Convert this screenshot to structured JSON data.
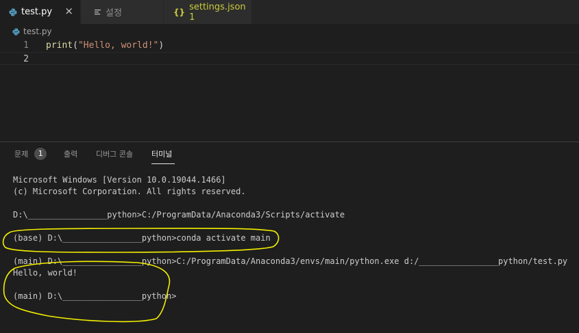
{
  "tabs": [
    {
      "label": "test.py",
      "close": "×",
      "icon": "python-icon"
    },
    {
      "label": "설정",
      "icon": "settings-list-icon"
    },
    {
      "label": "settings.json 1",
      "icon": "json-braces-icon",
      "glyph": "{}"
    }
  ],
  "breadcrumb": {
    "file": "test.py"
  },
  "editor": {
    "lines": [
      {
        "number": "1",
        "tokens": [
          {
            "text": "print",
            "type": "fn"
          },
          {
            "text": "(",
            "type": "punc"
          },
          {
            "text": "\"Hello, world!\"",
            "type": "str"
          },
          {
            "text": ")",
            "type": "punc"
          }
        ]
      },
      {
        "number": "2",
        "tokens": []
      }
    ]
  },
  "panel": {
    "tabs": [
      {
        "label": "문제",
        "badge": "1"
      },
      {
        "label": "출력"
      },
      {
        "label": "디버그 콘솔"
      },
      {
        "label": "터미널",
        "active": true
      }
    ]
  },
  "terminal": {
    "lines": [
      "Microsoft Windows [Version 10.0.19044.1466]",
      "(c) Microsoft Corporation. All rights reserved.",
      "",
      "D:\\________________python>C:/ProgramData/Anaconda3/Scripts/activate",
      "",
      "(base) D:\\________________python>conda activate main",
      "",
      "(main) D:\\________________python>C:/ProgramData/Anaconda3/envs/main/python.exe d:/________________python/test.py",
      "Hello, world!",
      "",
      "(main) D:\\________________python>"
    ]
  },
  "colors": {
    "background": "#1e1e1e",
    "tabbar": "#252526",
    "annotation": "#f5f000",
    "string": "#ce9178",
    "function": "#dcdcaa",
    "json_tab": "#cbcb41",
    "python_icon": "#519aba"
  }
}
